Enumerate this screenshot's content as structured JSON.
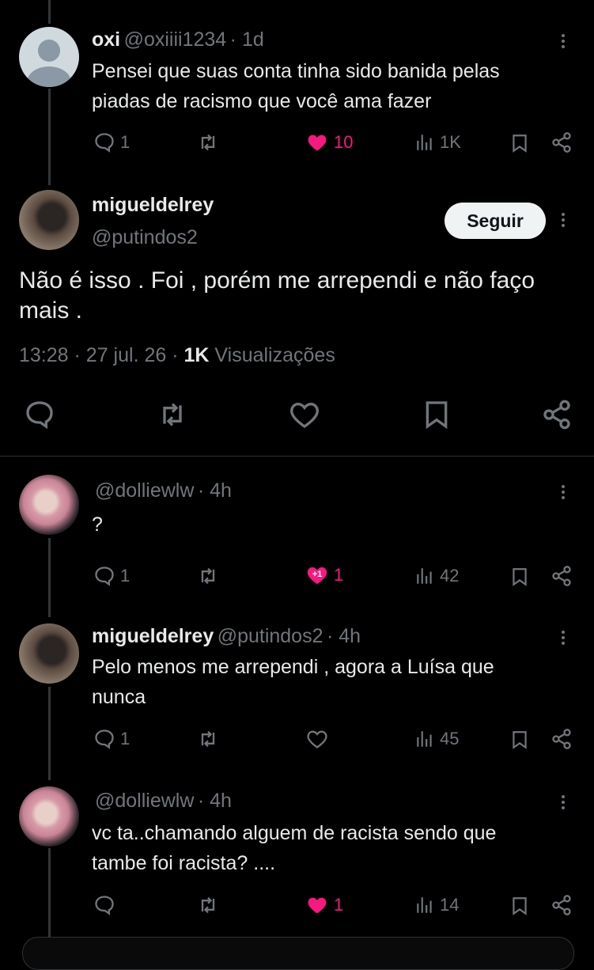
{
  "reply1": {
    "name": "oxi",
    "handle": "@oxiiii1234",
    "time": "1d",
    "text_line1": "Pensei que suas conta tinha sido banida pelas",
    "text_line2": "piadas de racismo que você ama fazer",
    "replies": "1",
    "likes": "10",
    "views": "1K"
  },
  "main_tweet": {
    "name": "migueldelrey",
    "handle": "@putindos2",
    "follow_label": "Seguir",
    "text_line1": "Não é isso . Foi , porém me arrependi e não faço",
    "text_line2": "mais .",
    "time": "13:28",
    "date": "27 jul. 26",
    "views_count": "1K",
    "views_label": "Visualizações"
  },
  "reply2": {
    "handle": "@dolliewlw",
    "time": "4h",
    "text": "?",
    "replies": "1",
    "like_badge": "+1",
    "likes": "1",
    "views": "42"
  },
  "reply3": {
    "name": "migueldelrey",
    "handle": "@putindos2",
    "time": "4h",
    "text_line1": "Pelo menos me arrependi , agora a Luísa que",
    "text_line2": "nunca",
    "replies": "1",
    "views": "45"
  },
  "reply4": {
    "handle": "@dolliewlw",
    "time": "4h",
    "text_line1": "vc ta..chamando alguem de racista sendo que",
    "text_line2": "tambe foi racista? ....",
    "likes": "1",
    "views": "14"
  },
  "colors": {
    "background": "#000000",
    "text": "#e7e9ea",
    "muted": "#71767b",
    "like": "#f91880"
  }
}
